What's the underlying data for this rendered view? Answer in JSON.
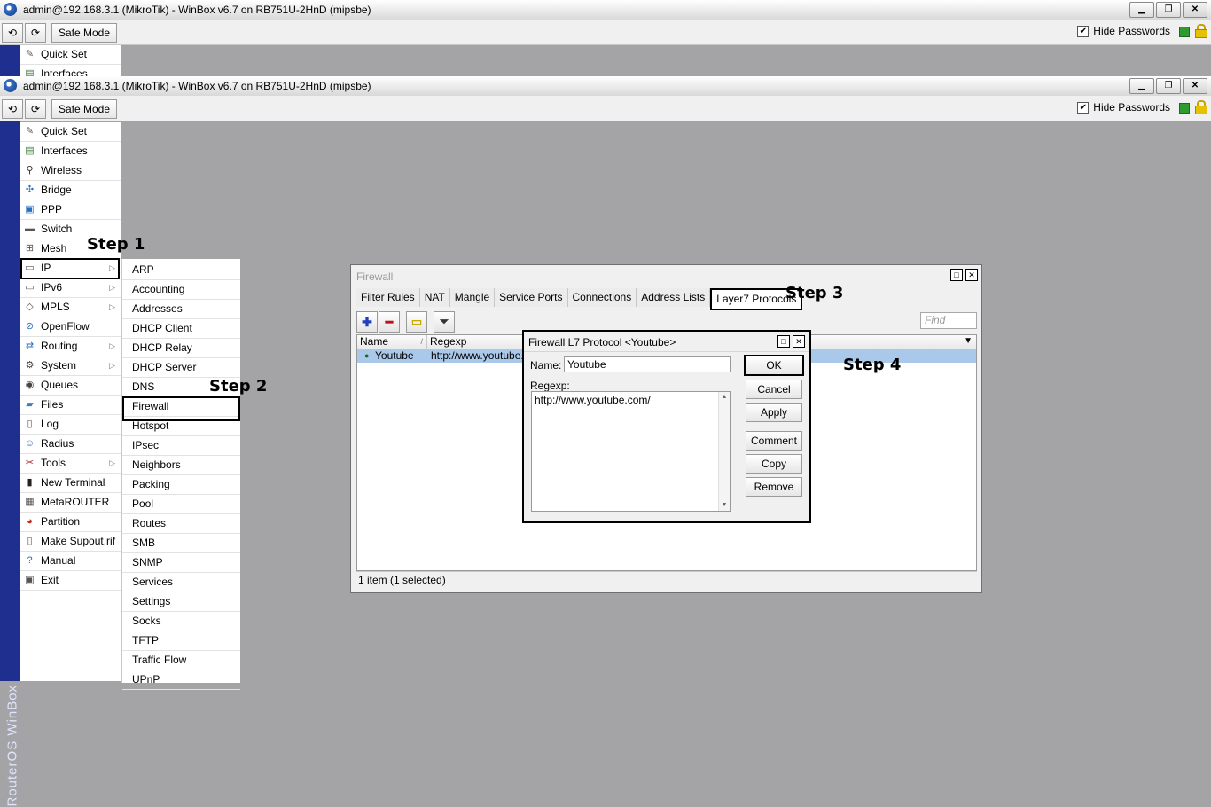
{
  "window": {
    "title": "admin@192.168.3.1 (MikroTik) - WinBox v6.7 on RB751U-2HnD (mipsbe)",
    "undo_icon": "undo-icon",
    "redo_icon": "redo-icon",
    "safe_mode": "Safe Mode",
    "hide_passwords": "Hide Passwords",
    "minimize": "▁",
    "maximize": "❐",
    "close": "✕"
  },
  "background_window": {
    "first_item": "Quick Set",
    "second_item_partial": "Interfaces"
  },
  "sidebar_brand": "RouterOS WinBox",
  "menu": [
    {
      "label": "Quick Set",
      "icon": "quick-set-icon",
      "glyph": "✎",
      "color": "#5a5a5a"
    },
    {
      "label": "Interfaces",
      "icon": "interfaces-icon",
      "glyph": "▤",
      "color": "#3a7a3a"
    },
    {
      "label": "Wireless",
      "icon": "wireless-icon",
      "glyph": "⚲",
      "color": "#333"
    },
    {
      "label": "Bridge",
      "icon": "bridge-icon",
      "glyph": "✣",
      "color": "#2a6fbd"
    },
    {
      "label": "PPP",
      "icon": "ppp-icon",
      "glyph": "▣",
      "color": "#2a6fbd"
    },
    {
      "label": "Switch",
      "icon": "switch-icon",
      "glyph": "▬",
      "color": "#555"
    },
    {
      "label": "Mesh",
      "icon": "mesh-icon",
      "glyph": "⊞",
      "color": "#555"
    },
    {
      "label": "IP",
      "icon": "ip-icon",
      "glyph": "▭",
      "color": "#555",
      "arrow": true
    },
    {
      "label": "IPv6",
      "icon": "ipv6-icon",
      "glyph": "▭",
      "color": "#555",
      "arrow": true
    },
    {
      "label": "MPLS",
      "icon": "mpls-icon",
      "glyph": "◇",
      "color": "#555",
      "arrow": true
    },
    {
      "label": "OpenFlow",
      "icon": "openflow-icon",
      "glyph": "⊘",
      "color": "#2a6fbd"
    },
    {
      "label": "Routing",
      "icon": "routing-icon",
      "glyph": "⇄",
      "color": "#2a6fbd",
      "arrow": true
    },
    {
      "label": "System",
      "icon": "system-icon",
      "glyph": "⚙",
      "color": "#444",
      "arrow": true
    },
    {
      "label": "Queues",
      "icon": "queues-icon",
      "glyph": "◉",
      "color": "#444"
    },
    {
      "label": "Files",
      "icon": "files-icon",
      "glyph": "▰",
      "color": "#3a7fc4"
    },
    {
      "label": "Log",
      "icon": "log-icon",
      "glyph": "▯",
      "color": "#555"
    },
    {
      "label": "Radius",
      "icon": "radius-icon",
      "glyph": "☺",
      "color": "#3a6fc4"
    },
    {
      "label": "Tools",
      "icon": "tools-icon",
      "glyph": "✂",
      "color": "#b02020",
      "arrow": true
    },
    {
      "label": "New Terminal",
      "icon": "terminal-icon",
      "glyph": "▮",
      "color": "#222"
    },
    {
      "label": "MetaROUTER",
      "icon": "metarouter-icon",
      "glyph": "▦",
      "color": "#555"
    },
    {
      "label": "Partition",
      "icon": "partition-icon",
      "glyph": "◕",
      "color": "#c03020"
    },
    {
      "label": "Make Supout.rif",
      "icon": "supout-icon",
      "glyph": "▯",
      "color": "#555"
    },
    {
      "label": "Manual",
      "icon": "manual-icon",
      "glyph": "?",
      "color": "#2a6fbd"
    },
    {
      "label": "Exit",
      "icon": "exit-icon",
      "glyph": "▣",
      "color": "#555"
    }
  ],
  "ip_submenu": [
    "ARP",
    "Accounting",
    "Addresses",
    "DHCP Client",
    "DHCP Relay",
    "DHCP Server",
    "DNS",
    "Firewall",
    "Hotspot",
    "IPsec",
    "Neighbors",
    "Packing",
    "Pool",
    "Routes",
    "SMB",
    "SNMP",
    "Services",
    "Settings",
    "Socks",
    "TFTP",
    "Traffic Flow",
    "UPnP"
  ],
  "steps": {
    "s1": "Step 1",
    "s2": "Step 2",
    "s3": "Step 3",
    "s4": "Step 4"
  },
  "firewall": {
    "title": "Firewall",
    "tabs": [
      "Filter Rules",
      "NAT",
      "Mangle",
      "Service Ports",
      "Connections",
      "Address Lists",
      "Layer7 Protocols"
    ],
    "find_placeholder": "Find",
    "columns": {
      "name": "Name",
      "regexp": "Regexp"
    },
    "row": {
      "name": "Youtube",
      "regexp": "http://www.youtube.c"
    },
    "status": "1 item (1 selected)"
  },
  "dialog": {
    "title": "Firewall L7 Protocol <Youtube>",
    "name_label": "Name:",
    "name_value": "Youtube",
    "regexp_label": "Regexp:",
    "regexp_value": "http://www.youtube.com/",
    "buttons": {
      "ok": "OK",
      "cancel": "Cancel",
      "apply": "Apply",
      "comment": "Comment",
      "copy": "Copy",
      "remove": "Remove"
    }
  }
}
